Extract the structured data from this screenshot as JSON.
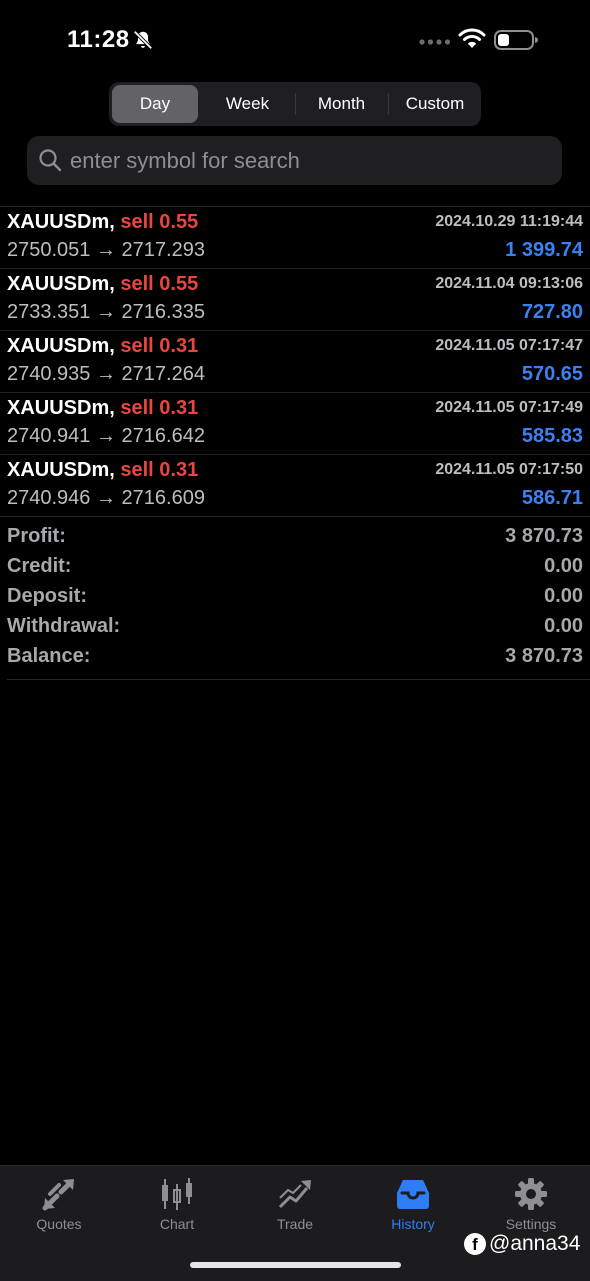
{
  "status_bar": {
    "time": "11:28",
    "icons": [
      "bell-slash-icon",
      "signal-dots-icon",
      "wifi-icon",
      "battery-icon"
    ]
  },
  "period_tabs": [
    {
      "label": "Day",
      "active": true
    },
    {
      "label": "Week",
      "active": false
    },
    {
      "label": "Month",
      "active": false
    },
    {
      "label": "Custom",
      "active": false
    }
  ],
  "search": {
    "placeholder": "enter symbol for search",
    "value": ""
  },
  "deals": [
    {
      "symbol": "XAUUSDm,",
      "side": "sell 0.55",
      "time": "2024.10.29 11:19:44",
      "prices": "2750.051 → 2717.293",
      "profit": "1 399.74"
    },
    {
      "symbol": "XAUUSDm,",
      "side": "sell 0.55",
      "time": "2024.11.04 09:13:06",
      "prices": "2733.351 → 2716.335",
      "profit": "727.80"
    },
    {
      "symbol": "XAUUSDm,",
      "side": "sell 0.31",
      "time": "2024.11.05 07:17:47",
      "prices": "2740.935 → 2717.264",
      "profit": "570.65"
    },
    {
      "symbol": "XAUUSDm,",
      "side": "sell 0.31",
      "time": "2024.11.05 07:17:49",
      "prices": "2740.941 → 2716.642",
      "profit": "585.83"
    },
    {
      "symbol": "XAUUSDm,",
      "side": "sell 0.31",
      "time": "2024.11.05 07:17:50",
      "prices": "2740.946 → 2716.609",
      "profit": "586.71"
    }
  ],
  "summary": [
    {
      "label": "Profit:",
      "value": "3 870.73"
    },
    {
      "label": "Credit:",
      "value": "0.00"
    },
    {
      "label": "Deposit:",
      "value": "0.00"
    },
    {
      "label": "Withdrawal:",
      "value": "0.00"
    },
    {
      "label": "Balance:",
      "value": "3 870.73"
    }
  ],
  "tabbar": [
    {
      "label": "Quotes",
      "icon": "quotes-arrows-icon",
      "active": false
    },
    {
      "label": "Chart",
      "icon": "candlestick-chart-icon",
      "active": false
    },
    {
      "label": "Trade",
      "icon": "trade-trend-icon",
      "active": false
    },
    {
      "label": "History",
      "icon": "history-tray-icon",
      "active": true
    },
    {
      "label": "Settings",
      "icon": "gear-icon",
      "active": false
    }
  ],
  "watermark": {
    "logo": "f",
    "text": "@anna34"
  },
  "colors": {
    "background": "#000000",
    "sell": "#e8463e",
    "profit": "#3b82f0",
    "active_tab": "#2f7df6",
    "inactive": "#8e8e93"
  }
}
